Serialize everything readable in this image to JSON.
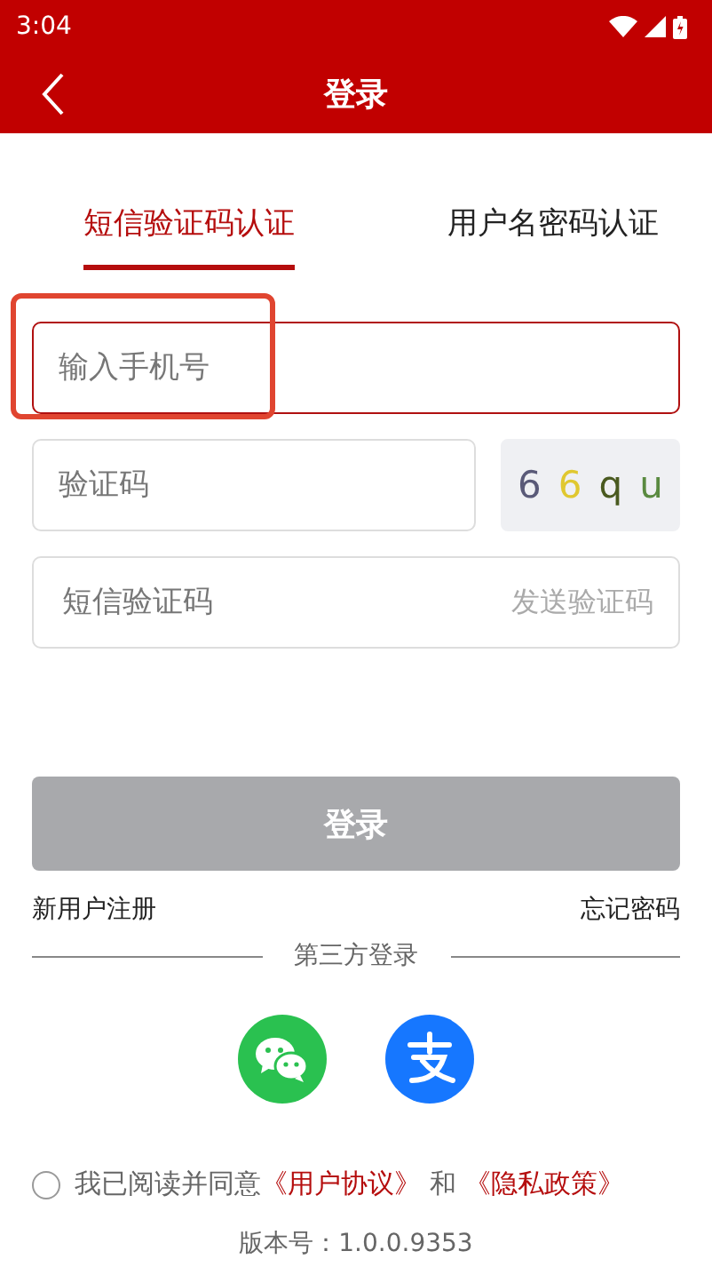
{
  "status_bar": {
    "time": "3:04"
  },
  "header": {
    "title": "登录"
  },
  "tabs": [
    {
      "label": "短信验证码认证",
      "selected": true
    },
    {
      "label": "用户名密码认证",
      "selected": false
    }
  ],
  "phone_field": {
    "placeholder": "输入手机号",
    "focused": true
  },
  "captcha_field": {
    "placeholder": "验证码"
  },
  "captcha": {
    "chars": [
      {
        "text": "6",
        "color": "#5a5a78"
      },
      {
        "text": "6",
        "color": "#e0c830"
      },
      {
        "text": "q",
        "color": "#4a5a20"
      },
      {
        "text": "u",
        "color": "#5a8a40"
      }
    ]
  },
  "sms_field": {
    "placeholder": "短信验证码",
    "action": "发送验证码"
  },
  "login_button": {
    "label": "登录",
    "disabled": true
  },
  "register_link": "新用户注册",
  "forgot_link": "忘记密码",
  "third_party": {
    "label": "第三方登录",
    "providers": [
      {
        "kind": "wechat"
      },
      {
        "kind": "alipay"
      }
    ]
  },
  "agreement": {
    "checked": false,
    "text": "我已阅读并同意",
    "links": [
      "《用户协议》",
      "《隐私政策》"
    ],
    "joiner": "和"
  },
  "version": "版本号：1.0.0.9353"
}
